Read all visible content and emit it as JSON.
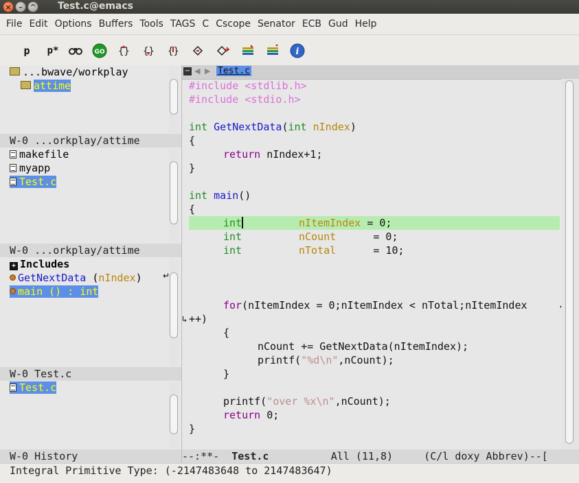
{
  "window": {
    "title": "Test.c@emacs"
  },
  "menu": [
    "File",
    "Edit",
    "Options",
    "Buffers",
    "Tools",
    "TAGS",
    "C",
    "Cscope",
    "Senator",
    "ECB",
    "Gud",
    "Help"
  ],
  "toolbar": {
    "icons": [
      "p-icon",
      "p-star-icon",
      "binoculars-icon",
      "go-icon",
      "brace-1-icon",
      "brace-2-icon",
      "brace-3-icon",
      "brace-4-icon",
      "brace-5-icon",
      "layers-1-icon",
      "layers-2-icon",
      "info-icon"
    ],
    "labels": {
      "p": "p",
      "pstar": "p*",
      "go": "GO",
      "info": "i"
    }
  },
  "directories": {
    "lines": [
      "...bwave/workplay",
      "attime"
    ],
    "modeline": "W-0 ...orkplay/attime"
  },
  "sources": {
    "files": [
      "makefile",
      "myapp",
      "Test.c"
    ],
    "modeline": "W-0 ...orkplay/attime"
  },
  "methods": {
    "group": "Includes",
    "items": [
      {
        "name": "GetNextData",
        "args": "nIndex"
      },
      {
        "name": "main () : int"
      }
    ],
    "modeline": "W-0 Test.c"
  },
  "history": {
    "items": [
      "Test.c"
    ],
    "modeline": "W-0 History"
  },
  "editor": {
    "tab": "Test.c",
    "code": {
      "inc1": "#include <stdlib.h>",
      "inc2": "#include <stdio.h>",
      "int": "int",
      "getnext": "GetNextData",
      "paren_open": "(",
      "nindex": "nIndex",
      "paren_close": ")",
      "brace_open": "{",
      "brace_close": "}",
      "return": "return",
      "ret_expr": " nIndex+1;",
      "main": "main",
      "main_parens": "()",
      "v1": "nItemIndex",
      "v2": "nCount",
      "v3": "nTotal",
      "a1": " = 0;",
      "a2": " = 0;",
      "a3": " = 10;",
      "for": "for",
      "for_rest": "(nItemIndex = 0;nItemIndex < nTotal;nItemIndex",
      "for_wrap": "++)",
      "ncount_line": "nCount += GetNextData(nItemIndex);",
      "printf": "printf(",
      "fmt1": "\"%d\\n\"",
      "printf1_rest": ",nCount);",
      "fmt2": "\"over %x\\n\"",
      "printf2_rest": ",nCount);",
      "ret0": " 0;"
    },
    "modeline": {
      "status": "--:**-",
      "buffer": "Test.c",
      "position": "All (11,8)",
      "modes": "(C/l doxy Abbrev)--["
    }
  },
  "minibuffer": "Integral Primitive Type: (-2147483648 to 2147483647)",
  "colors": {
    "highlight_bg": "#5b8fe8",
    "highlight_fg": "#ffff00",
    "current_line": "#b7ecb0",
    "keyword": "#8a008a",
    "type": "#228b22",
    "function": "#1a1acd",
    "variable": "#b8860b",
    "string": "#bc8f8f",
    "preprocessor": "#da70d6"
  }
}
